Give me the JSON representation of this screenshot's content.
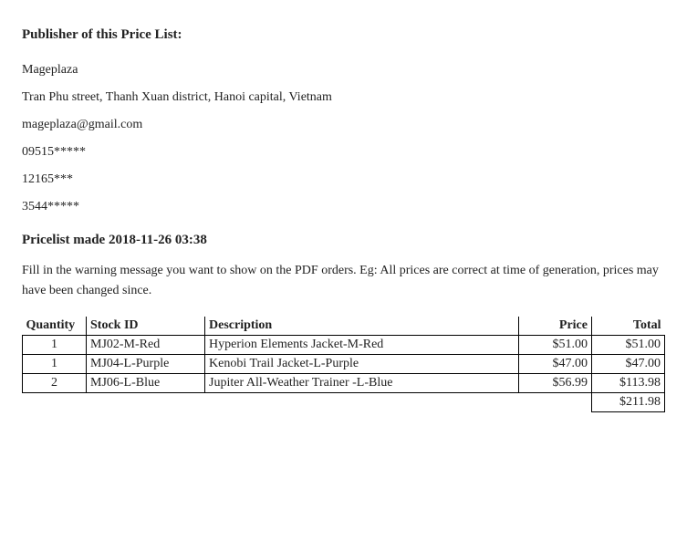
{
  "publisher_heading": "Publisher of this Price List:",
  "publisher": {
    "name": "Mageplaza",
    "address": "Tran Phu street, Thanh Xuan district, Hanoi capital, Vietnam",
    "email": "mageplaza@gmail.com",
    "phone1": "09515*****",
    "phone2": "12165***",
    "phone3": "3544*****"
  },
  "pricelist_heading": "Pricelist made 2018-11-26 03:38",
  "warning_text": "Fill in the warning message you want to show on the PDF orders. Eg: All prices are correct at time of generation, prices may have been changed since.",
  "columns": {
    "quantity": "Quantity",
    "stock_id": "Stock ID",
    "description": "Description",
    "price": "Price",
    "total": "Total"
  },
  "rows": [
    {
      "quantity": "1",
      "stock_id": "MJ02-M-Red",
      "description": "Hyperion Elements Jacket-M-Red",
      "price": "$51.00",
      "total": "$51.00"
    },
    {
      "quantity": "1",
      "stock_id": "MJ04-L-Purple",
      "description": "Kenobi Trail Jacket-L-Purple",
      "price": "$47.00",
      "total": "$47.00"
    },
    {
      "quantity": "2",
      "stock_id": "MJ06-L-Blue",
      "description": "Jupiter All-Weather Trainer -L-Blue",
      "price": "$56.99",
      "total": "$113.98"
    }
  ],
  "grand_total": "$211.98"
}
